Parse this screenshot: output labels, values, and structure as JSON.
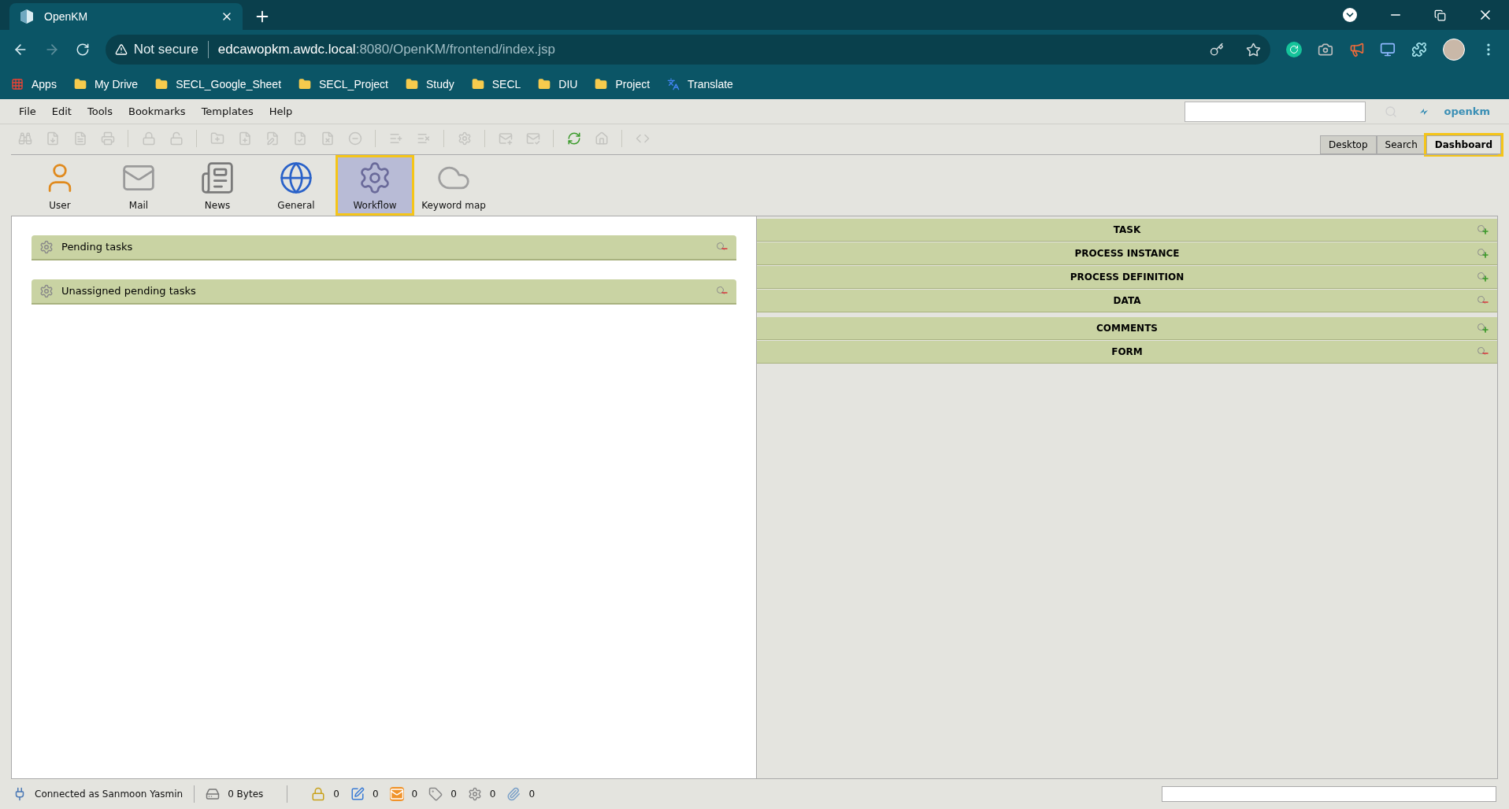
{
  "browser": {
    "tab_title": "OpenKM",
    "address": {
      "security": "Not secure",
      "host": "edcawopkm.awdc.local",
      "path": ":8080/OpenKM/frontend/index.jsp"
    },
    "bookmarks": [
      {
        "kind": "apps",
        "label": "Apps"
      },
      {
        "kind": "folder",
        "label": "My Drive"
      },
      {
        "kind": "folder",
        "label": "SECL_Google_Sheet"
      },
      {
        "kind": "folder",
        "label": "SECL_Project"
      },
      {
        "kind": "folder",
        "label": "Study"
      },
      {
        "kind": "folder",
        "label": "SECL"
      },
      {
        "kind": "folder",
        "label": "DIU"
      },
      {
        "kind": "folder",
        "label": "Project"
      },
      {
        "kind": "translate",
        "label": "Translate"
      }
    ]
  },
  "logo": "openkm",
  "menu": [
    "File",
    "Edit",
    "Tools",
    "Bookmarks",
    "Templates",
    "Help"
  ],
  "toolbar_groups": [
    [
      {
        "disabled": true
      },
      {
        "disabled": true
      },
      {
        "disabled": true
      },
      {
        "disabled": true
      }
    ],
    [
      {
        "disabled": true
      },
      {
        "disabled": true
      }
    ],
    [
      {
        "disabled": true
      },
      {
        "disabled": true
      },
      {
        "disabled": true
      },
      {
        "disabled": true
      },
      {
        "disabled": true
      },
      {
        "disabled": true
      }
    ],
    [
      {
        "disabled": true
      },
      {
        "disabled": true
      }
    ],
    [
      {
        "disabled": true
      }
    ],
    [
      {
        "disabled": true
      },
      {
        "disabled": true
      }
    ],
    [
      {
        "disabled": false
      },
      {
        "disabled": true
      }
    ],
    [
      {
        "disabled": true
      }
    ]
  ],
  "view_tabs": [
    {
      "label": "Desktop",
      "selected": false
    },
    {
      "label": "Search",
      "selected": false
    },
    {
      "label": "Dashboard",
      "selected": true
    }
  ],
  "dashboard_tabs": [
    {
      "kind": "user",
      "label": "User",
      "selected": false
    },
    {
      "kind": "mail",
      "label": "Mail",
      "selected": false
    },
    {
      "kind": "news",
      "label": "News",
      "selected": false
    },
    {
      "kind": "general",
      "label": "General",
      "selected": false
    },
    {
      "kind": "workflow",
      "label": "Workflow",
      "selected": true
    },
    {
      "kind": "keyword",
      "label": "Keyword map",
      "selected": false
    }
  ],
  "workflow_panels": [
    {
      "title": "Pending tasks",
      "expanded": true
    },
    {
      "title": "Unassigned pending tasks",
      "expanded": true
    }
  ],
  "detail_panel_groups": [
    [
      {
        "title": "TASK",
        "expanded": false
      },
      {
        "title": "PROCESS INSTANCE",
        "expanded": false
      },
      {
        "title": "PROCESS DEFINITION",
        "expanded": false
      },
      {
        "title": "DATA",
        "expanded": true
      }
    ],
    [
      {
        "title": "COMMENTS",
        "expanded": false
      },
      {
        "title": "FORM",
        "expanded": true
      }
    ]
  ],
  "status_bar": {
    "user": "Connected as Sanmoon Yasmin",
    "size": "0 Bytes",
    "counters": [
      {
        "kind": "locked",
        "value": "0"
      },
      {
        "kind": "checkout",
        "value": "0"
      },
      {
        "kind": "mail",
        "value": "0"
      },
      {
        "kind": "tag",
        "value": "0"
      },
      {
        "kind": "workflow",
        "value": "0"
      },
      {
        "kind": "attachment",
        "value": "0"
      }
    ]
  }
}
